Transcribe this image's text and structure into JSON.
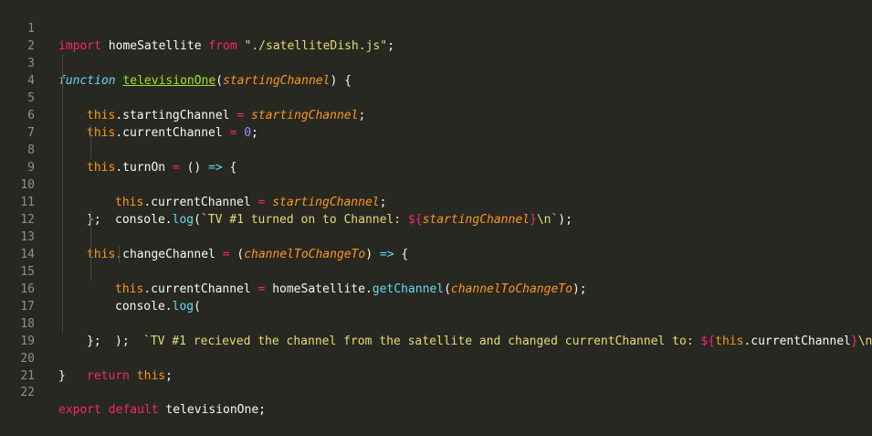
{
  "editor": {
    "line_numbers": [
      "1",
      "2",
      "3",
      "4",
      "5",
      "6",
      "7",
      "8",
      "9",
      "10",
      "11",
      "12",
      "13",
      "14",
      "15",
      "16",
      "17",
      "18",
      "19",
      "20",
      "21",
      "22"
    ],
    "l1": {
      "kw_import": "import",
      "name": " homeSatellite ",
      "kw_from": "from",
      "sp": " ",
      "str": "\"./satelliteDish.js\"",
      "end": ";"
    },
    "l3": {
      "kw_function": "function",
      "sp": " ",
      "fname": "televisionOne",
      "open": "(",
      "param": "startingChannel",
      "close": ") {"
    },
    "l4": {
      "this": "this",
      "prop": ".startingChannel ",
      "eq": "=",
      "sp": " ",
      "param": "startingChannel",
      "end": ";"
    },
    "l5": {
      "this": "this",
      "prop": ".currentChannel ",
      "eq": "=",
      "sp": " ",
      "num": "0",
      "end": ";"
    },
    "l7": {
      "this": "this",
      "prop": ".turnOn ",
      "eq": "=",
      "rest": " () ",
      "arrow": "=>",
      "end": " {"
    },
    "l8": {
      "this": "this",
      "prop": ".currentChannel ",
      "eq": "=",
      "sp": " ",
      "param": "startingChannel",
      "end": ";"
    },
    "l9": {
      "obj": "console",
      "dot": ".",
      "method": "log",
      "open": "(",
      "str1": "`TV #1 turned on to Channel: ",
      "tpl_open": "${",
      "param": "startingChannel",
      "tpl_close": "}",
      "str2": "\\n`",
      "end": ");"
    },
    "l10": {
      "text": "};"
    },
    "l12": {
      "this": "this",
      "prop": ".changeChannel ",
      "eq": "=",
      "sp": " (",
      "param": "channelToChangeTo",
      "rest": ") ",
      "arrow": "=>",
      "end": " {"
    },
    "l13": {
      "this": "this",
      "prop": ".currentChannel ",
      "eq": "=",
      "sp": " homeSatellite.",
      "method": "getChannel",
      "open": "(",
      "param": "channelToChangeTo",
      "end": ");"
    },
    "l14": {
      "obj": "console",
      "dot": ".",
      "method": "log",
      "open": "("
    },
    "l15": {
      "str1": "`TV #1 recieved the channel from the satellite and changed currentChannel to: ",
      "tpl_open": "${",
      "this": "this",
      "prop": ".currentChannel",
      "tpl_close": "}",
      "str2": "\\n`"
    },
    "l16": {
      "text": ");"
    },
    "l17": {
      "text": "};"
    },
    "l19": {
      "kw_return": "return",
      "sp": " ",
      "this": "this",
      "end": ";"
    },
    "l20": {
      "text": "}"
    },
    "l22": {
      "kw_export": "export",
      "sp1": " ",
      "kw_default": "default",
      "rest": " televisionOne;"
    }
  }
}
